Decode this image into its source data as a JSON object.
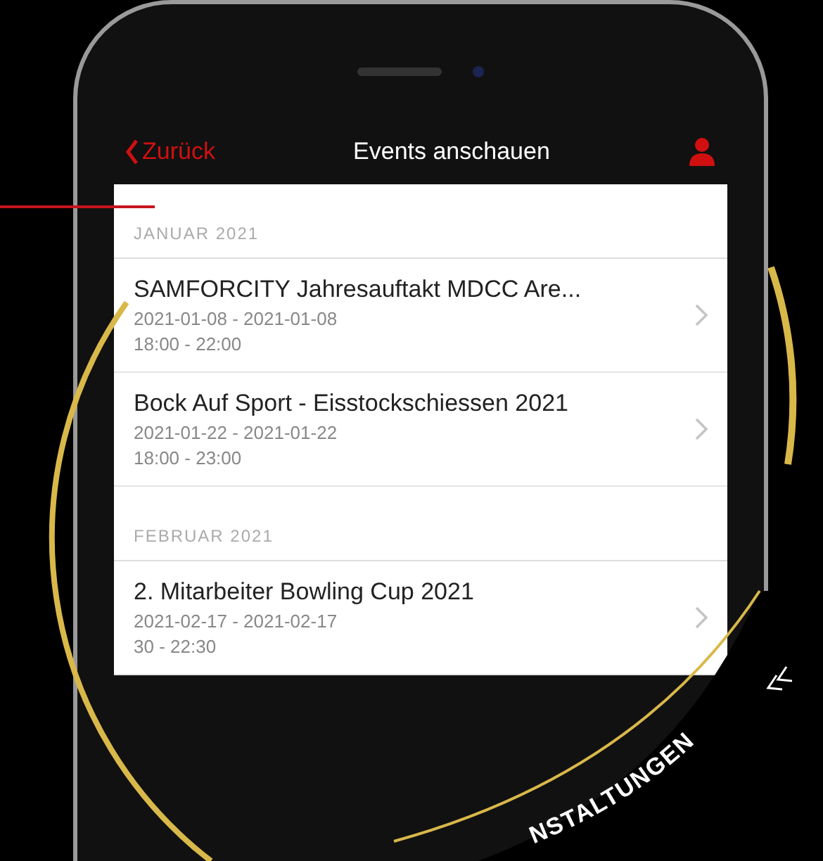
{
  "nav": {
    "back": "Zurück",
    "title": "Events anschauen"
  },
  "sections": [
    {
      "header": "JANUAR 2021",
      "events": [
        {
          "title": "SAMFORCITY Jahresauftakt MDCC Are...",
          "dates": "2021-01-08 - 2021-01-08",
          "times": "18:00 - 22:00"
        },
        {
          "title": "Bock Auf Sport - Eisstockschiessen 2021",
          "dates": "2021-01-22 - 2021-01-22",
          "times": "18:00 - 23:00"
        }
      ]
    },
    {
      "header": "FEBRUAR 2021",
      "events": [
        {
          "title": "2. Mitarbeiter Bowling Cup 2021",
          "dates": "2021-02-17 - 2021-02-17",
          "times": "30 - 22:30"
        }
      ]
    }
  ],
  "banner": "NSTALTUNGEN"
}
